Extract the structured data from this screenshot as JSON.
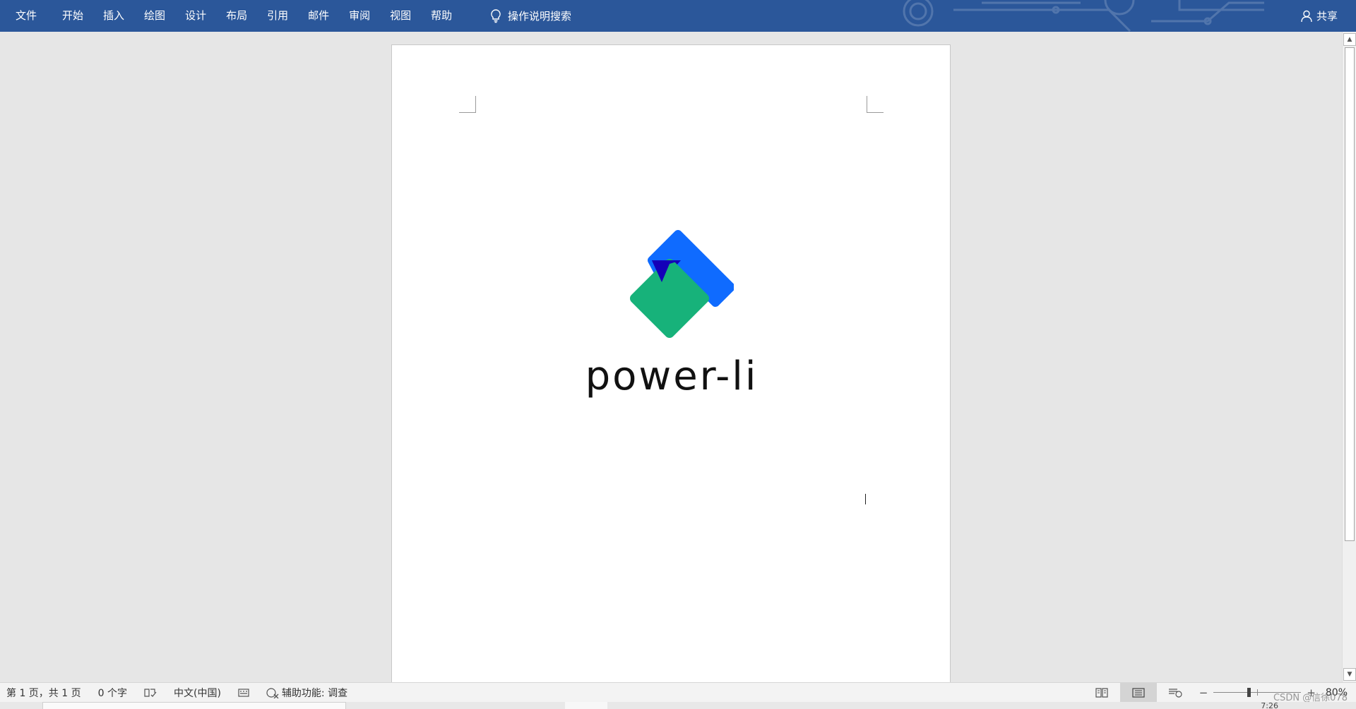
{
  "menubar": {
    "items": [
      "文件",
      "开始",
      "插入",
      "绘图",
      "设计",
      "布局",
      "引用",
      "邮件",
      "审阅",
      "视图",
      "帮助"
    ],
    "tell_me": "操作说明搜索",
    "share": "共享",
    "background_color": "#2b579a"
  },
  "document": {
    "logo_text": "power-li",
    "logo_colors": {
      "blue": "#0f6bff",
      "dark_blue": "#1400b8",
      "green": "#17b27a"
    }
  },
  "statusbar": {
    "page_info": "第 1 页，共 1 页",
    "word_count": "0 个字",
    "language": "中文(中国)",
    "accessibility": "辅助功能: 调查",
    "zoom_minus": "−",
    "zoom_plus": "+",
    "zoom_level": "80%"
  },
  "watermark": "CSDN @信徐078",
  "taskbar": {
    "time": "7:26"
  }
}
